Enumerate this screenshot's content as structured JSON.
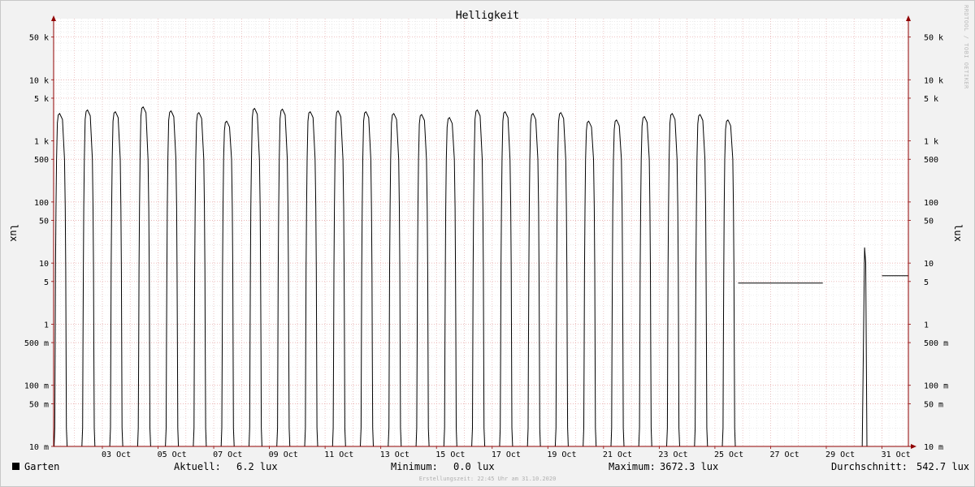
{
  "chart_data": {
    "type": "line",
    "title": "Helligkeit",
    "ylabel_left": "lux",
    "ylabel_right": "lux",
    "yscale": "log",
    "ylim": [
      0.01,
      100000
    ],
    "yticks": [
      {
        "v": 0.01,
        "label": "10 m"
      },
      {
        "v": 0.05,
        "label": "50 m"
      },
      {
        "v": 0.1,
        "label": "100 m"
      },
      {
        "v": 0.5,
        "label": "500 m"
      },
      {
        "v": 1,
        "label": "1"
      },
      {
        "v": 5,
        "label": "5"
      },
      {
        "v": 10,
        "label": "10"
      },
      {
        "v": 50,
        "label": "50"
      },
      {
        "v": 100,
        "label": "100"
      },
      {
        "v": 500,
        "label": "500"
      },
      {
        "v": 1000,
        "label": "1 k"
      },
      {
        "v": 5000,
        "label": "5 k"
      },
      {
        "v": 10000,
        "label": "10 k"
      },
      {
        "v": 50000,
        "label": "50 k"
      }
    ],
    "xlim": [
      "2020-10-01 06:00",
      "2020-10-31 22:45"
    ],
    "xticks": [
      {
        "day": 3,
        "label": "03 Oct"
      },
      {
        "day": 5,
        "label": "05 Oct"
      },
      {
        "day": 7,
        "label": "07 Oct"
      },
      {
        "day": 9,
        "label": "09 Oct"
      },
      {
        "day": 11,
        "label": "11 Oct"
      },
      {
        "day": 13,
        "label": "13 Oct"
      },
      {
        "day": 15,
        "label": "15 Oct"
      },
      {
        "day": 17,
        "label": "17 Oct"
      },
      {
        "day": 19,
        "label": "19 Oct"
      },
      {
        "day": 21,
        "label": "21 Oct"
      },
      {
        "day": 23,
        "label": "23 Oct"
      },
      {
        "day": 25,
        "label": "25 Oct"
      },
      {
        "day": 27,
        "label": "27 Oct"
      },
      {
        "day": 29,
        "label": "29 Oct"
      },
      {
        "day": 31,
        "label": "31 Oct"
      }
    ],
    "daily_peaks": [
      {
        "day": 1,
        "peak_lux": 2800
      },
      {
        "day": 2,
        "peak_lux": 3200
      },
      {
        "day": 3,
        "peak_lux": 3000
      },
      {
        "day": 4,
        "peak_lux": 3600
      },
      {
        "day": 5,
        "peak_lux": 3100
      },
      {
        "day": 6,
        "peak_lux": 2900
      },
      {
        "day": 7,
        "peak_lux": 2100
      },
      {
        "day": 8,
        "peak_lux": 3400
      },
      {
        "day": 9,
        "peak_lux": 3300
      },
      {
        "day": 10,
        "peak_lux": 3000
      },
      {
        "day": 11,
        "peak_lux": 3100
      },
      {
        "day": 12,
        "peak_lux": 3000
      },
      {
        "day": 13,
        "peak_lux": 2800
      },
      {
        "day": 14,
        "peak_lux": 2700
      },
      {
        "day": 15,
        "peak_lux": 2400
      },
      {
        "day": 16,
        "peak_lux": 3200
      },
      {
        "day": 17,
        "peak_lux": 3000
      },
      {
        "day": 18,
        "peak_lux": 2800
      },
      {
        "day": 19,
        "peak_lux": 2900
      },
      {
        "day": 20,
        "peak_lux": 2100
      },
      {
        "day": 21,
        "peak_lux": 2200
      },
      {
        "day": 22,
        "peak_lux": 2500
      },
      {
        "day": 23,
        "peak_lux": 2800
      },
      {
        "day": 24,
        "peak_lux": 2700
      },
      {
        "day": 25,
        "peak_lux": 2200
      }
    ],
    "constant_segments": [
      {
        "from": "2020-10-25 20:00",
        "to": "2020-10-28 21:00",
        "value": 4.7
      },
      {
        "from": "2020-10-31 00:00",
        "to": "2020-10-31 22:45",
        "value": 6.2
      }
    ],
    "series": [
      {
        "name": "Garten",
        "color": "#000000"
      }
    ],
    "legend_position": "bottom-left",
    "grid": true
  },
  "legend": {
    "series_name": "Garten",
    "current_label": "Aktuell:",
    "current_value": "6.2 lux",
    "min_label": "Minimum:",
    "min_value": "0.0 lux",
    "max_label": "Maximum:",
    "max_value": "3672.3 lux",
    "avg_label": "Durchschnitt:",
    "avg_value": "542.7 lux"
  },
  "footer": "Erstellungszeit: 22:45 Uhr am 31.10.2020",
  "watermark": "RRDTOOL / TOBI OETIKER",
  "colors": {
    "background": "#f2f2f2",
    "plot_bg": "#ffffff",
    "line": "#000000",
    "grid_major": "#e8a0a0",
    "grid_minor": "#dddddd",
    "axis": "#900000"
  }
}
